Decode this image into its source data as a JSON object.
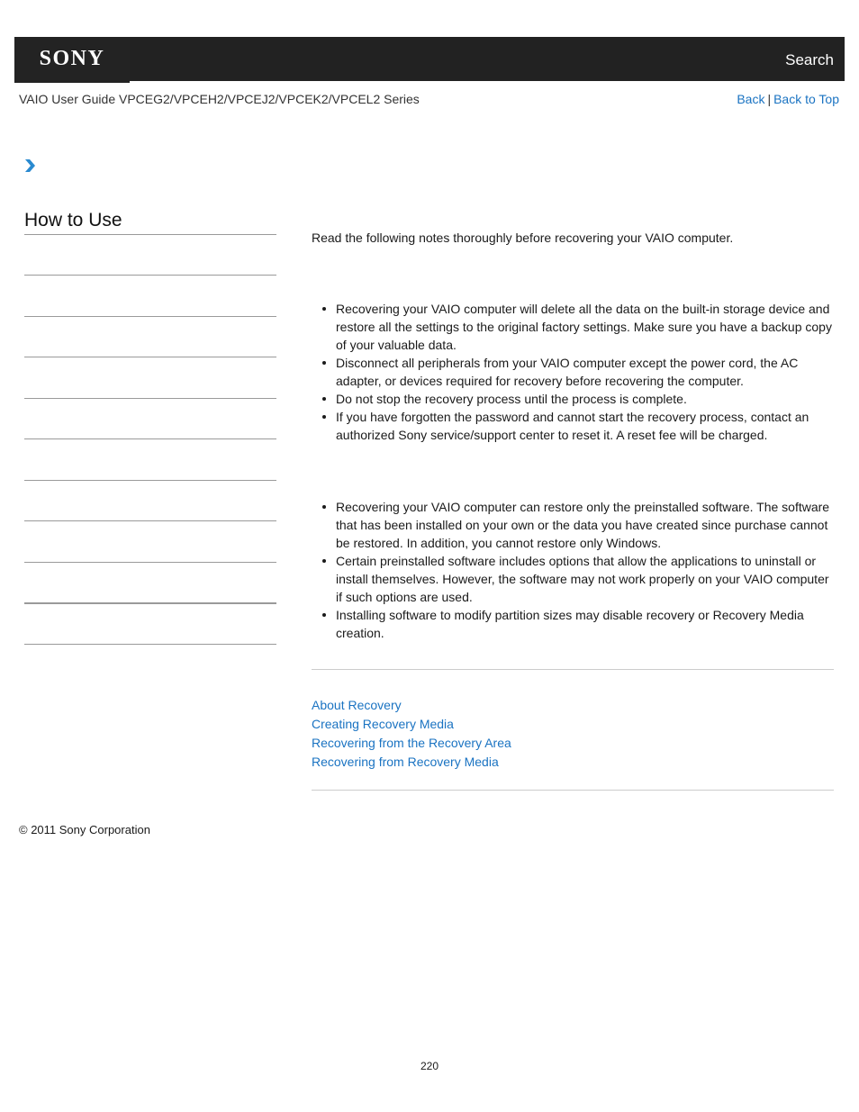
{
  "header": {
    "logo": "SONY",
    "search_label": "Search"
  },
  "nav": {
    "guide_title": "VAIO User Guide VPCEG2/VPCEH2/VPCEJ2/VPCEK2/VPCEL2 Series",
    "back_label": "Back",
    "separator": "|",
    "back_to_top_label": "Back to Top"
  },
  "icons": {
    "breadcrumb": "chevron-right-icon"
  },
  "colors": {
    "header_bg": "#222222",
    "link": "#1a73c2",
    "chevron": "#2a8ad0"
  },
  "sidebar": {
    "title": "How to Use",
    "item_count": 10
  },
  "main": {
    "intro": "Read the following notes thoroughly before recovering your VAIO computer.",
    "notes_group_1": [
      "Recovering your VAIO computer will delete all the data on the built-in storage device and restore all the settings to the original factory settings. Make sure you have a backup copy of your valuable data.",
      "Disconnect all peripherals from your VAIO computer except the power cord, the AC adapter, or devices required for recovery before recovering the computer.",
      "Do not stop the recovery process until the process is complete.",
      "If you have forgotten the password and cannot start the recovery process, contact an authorized Sony service/support center to reset it. A reset fee will be charged."
    ],
    "notes_group_2": [
      "Recovering your VAIO computer can restore only the preinstalled software. The software that has been installed on your own or the data you have created since purchase cannot be restored. In addition, you cannot restore only Windows.",
      "Certain preinstalled software includes options that allow the applications to uninstall or install themselves. However, the software may not work properly on your VAIO computer if such options are used.",
      "Installing software to modify partition sizes may disable recovery or Recovery Media creation."
    ],
    "related_links": [
      "About Recovery",
      "Creating Recovery Media",
      "Recovering from the Recovery Area",
      "Recovering from Recovery Media"
    ]
  },
  "footer": {
    "copyright": "© 2011 Sony Corporation",
    "page_number": "220"
  }
}
